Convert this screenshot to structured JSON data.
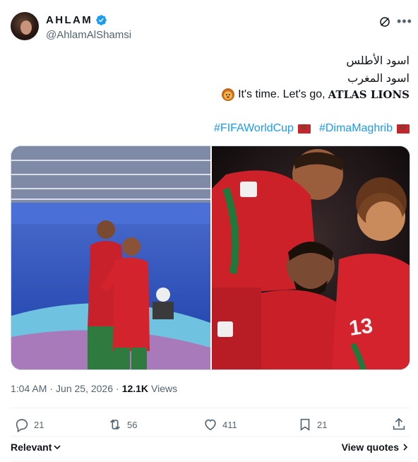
{
  "author": {
    "display_name": "AHLAM",
    "handle": "@AhlamAlShamsi",
    "verified_color": "#1d9bf0"
  },
  "tweet": {
    "line1": "اسود الأطلس",
    "line2": "اسود المغرب",
    "line3_prefix": "It's time. Let's go,",
    "line3_emphasis": "ATLAS LIONS",
    "hashtag1": "#FIFAWorldCup",
    "hashtag2": "#DimaMaghrib",
    "link_color": "#1d9bf0"
  },
  "media": {
    "image1": "two Morocco players embracing on pitch",
    "image2": "Morocco players celebrating a goal"
  },
  "meta": {
    "time": "1:04 AM",
    "date": "Jun 25, 2026",
    "separator": "·",
    "views_count": "12.1K",
    "views_label": "Views"
  },
  "actions": {
    "replies": "21",
    "reposts": "56",
    "likes": "411",
    "bookmarks": "21"
  },
  "footer": {
    "sort_label": "Relevant",
    "view_quotes_label": "View quotes"
  }
}
